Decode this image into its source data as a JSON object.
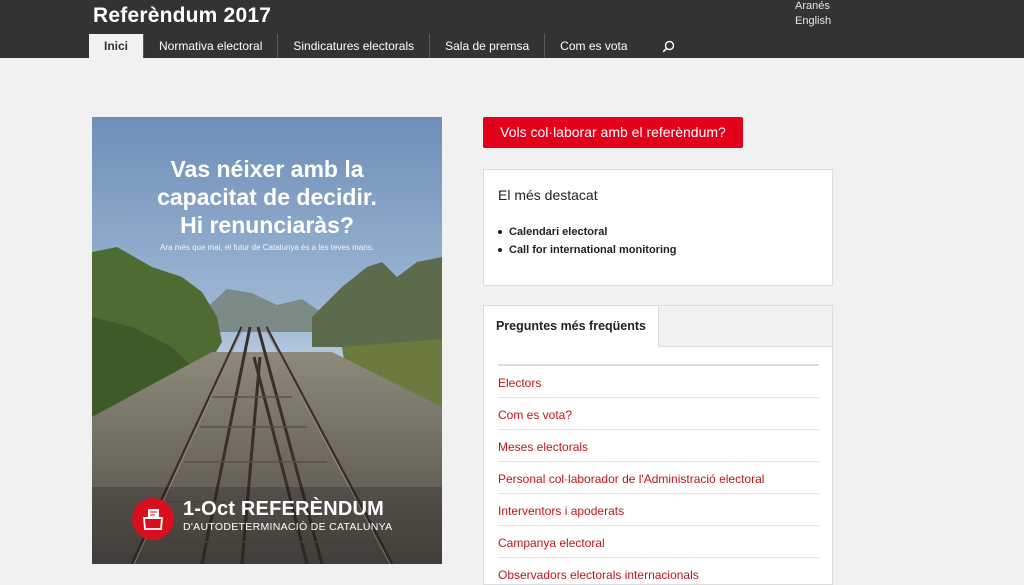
{
  "header": {
    "title": "Referèndum 2017",
    "languages": [
      "Aranés",
      "English"
    ],
    "nav": [
      {
        "label": "Inici",
        "active": true
      },
      {
        "label": "Normativa electoral",
        "active": false
      },
      {
        "label": "Sindicatures electorals",
        "active": false
      },
      {
        "label": "Sala de premsa",
        "active": false
      },
      {
        "label": "Com es vota",
        "active": false
      }
    ],
    "search_icon": "search-icon"
  },
  "poster": {
    "headline_lines": [
      "Vas néixer amb la",
      "capacitat de decidir.",
      "Hi renunciaràs?"
    ],
    "subline": "Ara més que mai, el futur de Catalunya és a les teves mans.",
    "ref_title": "1-Oct REFERÈNDUM",
    "ref_subtitle": "D'AUTODETERMINACIÓ DE CATALUNYA",
    "badge_icon": "ballot-box-icon"
  },
  "cta": {
    "label": "Vols col·laborar amb el referèndum?"
  },
  "highlights": {
    "title": "El més destacat",
    "items": [
      "Calendari electoral",
      "Call for international monitoring"
    ]
  },
  "faq": {
    "tab": "Preguntes més freqüents",
    "items": [
      "Electors",
      "Com es vota?",
      "Meses electorals",
      "Personal col·laborador de l'Administració electoral",
      "Interventors i apoderats",
      "Campanya electoral",
      "Observadors electorals internacionals"
    ]
  },
  "colors": {
    "header_bg": "#333333",
    "accent_red": "#e3001b",
    "link_red": "#c0141c",
    "page_bg": "#f1f1f1"
  }
}
